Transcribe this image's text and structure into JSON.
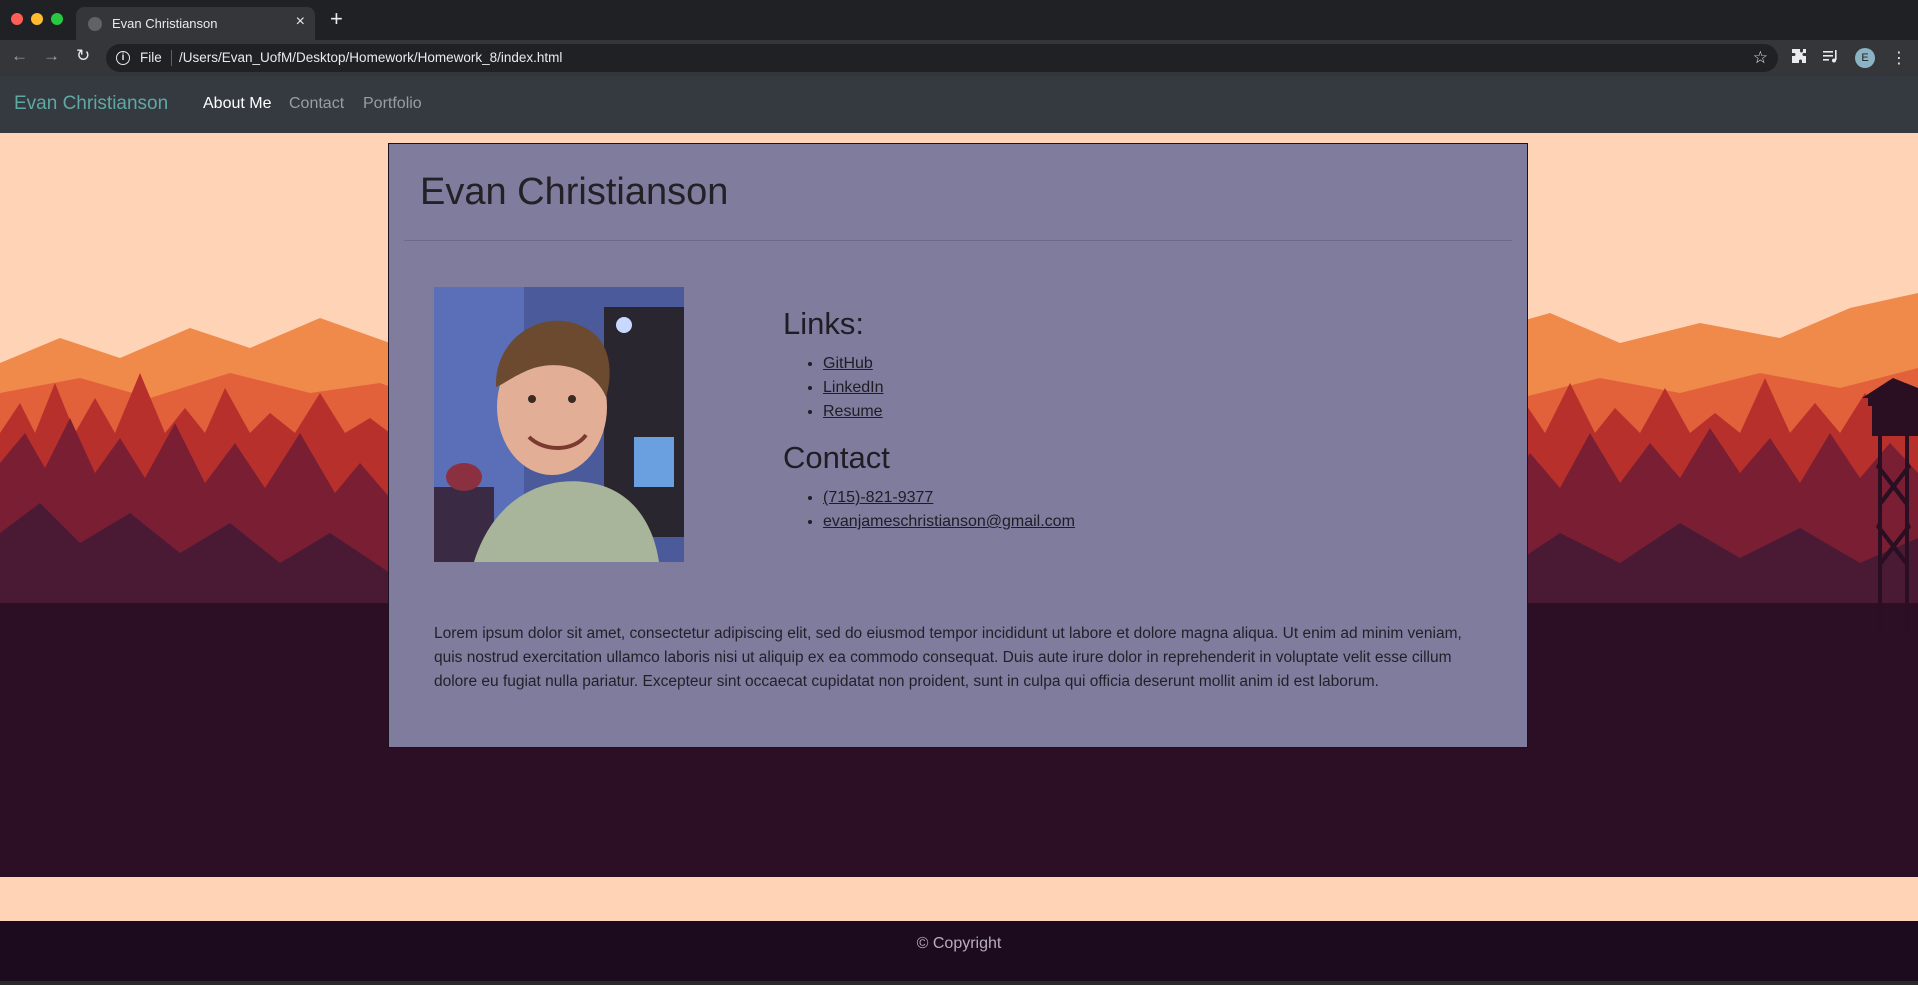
{
  "browser": {
    "tab_title": "Evan Christianson",
    "tab_close": "×",
    "new_tab": "+",
    "back": "←",
    "forward": "→",
    "reload": "↻",
    "scheme_label": "File",
    "url": "/Users/Evan_UofM/Desktop/Homework/Homework_8/index.html",
    "bookmark": "☆",
    "profile_initial": "E",
    "menu": "⋮"
  },
  "navbar": {
    "brand": "Evan Christianson",
    "links": [
      {
        "label": "About Me",
        "active": true
      },
      {
        "label": "Contact",
        "active": false
      },
      {
        "label": "Portfolio",
        "active": false
      }
    ]
  },
  "card": {
    "title": "Evan Christianson",
    "links_heading": "Links:",
    "links": [
      "GitHub",
      "LinkedIn",
      "Resume"
    ],
    "contact_heading": "Contact",
    "contact": [
      "(715)-821-9377",
      "evanjameschristianson@gmail.com"
    ],
    "bio": "Lorem ipsum dolor sit amet, consectetur adipiscing elit, sed do eiusmod tempor incididunt ut labore et dolore magna aliqua. Ut enim ad minim veniam, quis nostrud exercitation ullamco laboris nisi ut aliquip ex ea commodo consequat. Duis aute irure dolor in reprehenderit in voluptate velit esse cillum dolore eu fugiat nulla pariatur. Excepteur sint occaecat cupidatat non proident, sunt in culpa qui officia deserunt mollit anim id est laborum."
  },
  "footer": {
    "text": "© Copyright"
  },
  "colors": {
    "navbar_bg": "#343a40",
    "brand": "#5fa8a3",
    "card_bg": "#807c9e",
    "page_bg": "#ffd3b6",
    "footer_bg": "#1c0a1f"
  }
}
